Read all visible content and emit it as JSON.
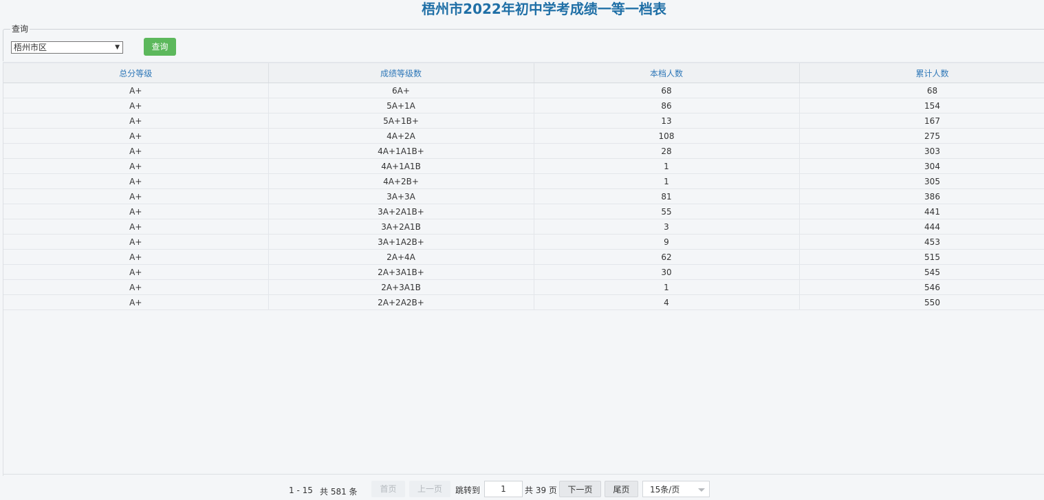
{
  "title": "梧州市2022年初中学考成绩一等一档表",
  "query": {
    "legend": "查询",
    "region_selected": "梧州市区",
    "button_label": "查询"
  },
  "table": {
    "headers": [
      "总分等级",
      "成绩等级数",
      "本档人数",
      "累计人数"
    ],
    "rows": [
      [
        "A+",
        "6A+",
        "68",
        "68"
      ],
      [
        "A+",
        "5A+1A",
        "86",
        "154"
      ],
      [
        "A+",
        "5A+1B+",
        "13",
        "167"
      ],
      [
        "A+",
        "4A+2A",
        "108",
        "275"
      ],
      [
        "A+",
        "4A+1A1B+",
        "28",
        "303"
      ],
      [
        "A+",
        "4A+1A1B",
        "1",
        "304"
      ],
      [
        "A+",
        "4A+2B+",
        "1",
        "305"
      ],
      [
        "A+",
        "3A+3A",
        "81",
        "386"
      ],
      [
        "A+",
        "3A+2A1B+",
        "55",
        "441"
      ],
      [
        "A+",
        "3A+2A1B",
        "3",
        "444"
      ],
      [
        "A+",
        "3A+1A2B+",
        "9",
        "453"
      ],
      [
        "A+",
        "2A+4A",
        "62",
        "515"
      ],
      [
        "A+",
        "2A+3A1B+",
        "30",
        "545"
      ],
      [
        "A+",
        "2A+3A1B",
        "1",
        "546"
      ],
      [
        "A+",
        "2A+2A2B+",
        "4",
        "550"
      ]
    ]
  },
  "pager": {
    "range": "1 - 15",
    "total": "共 581 条",
    "first": "首页",
    "prev": "上一页",
    "jump_label": "跳转到",
    "current_page": "1",
    "pages_total": "共 39 页",
    "next": "下一页",
    "last": "尾页",
    "page_size": "15条/页"
  }
}
